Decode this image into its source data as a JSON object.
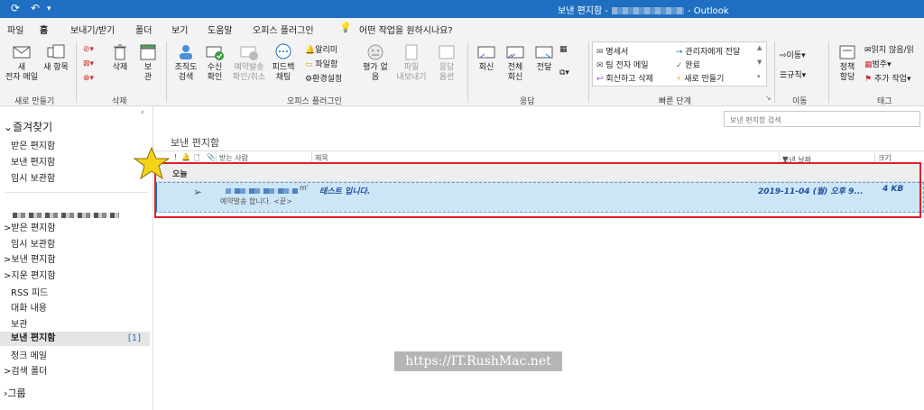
{
  "titlebar": {
    "title_prefix": "보낸 편지함 -",
    "app_name": "- Outlook"
  },
  "menu": {
    "tabs": [
      "파일",
      "홈",
      "보내기/받기",
      "폴더",
      "보기",
      "도움말",
      "오피스 플러그인"
    ],
    "tell_me": "어떤 작업을 원하시나요?"
  },
  "ribbon": {
    "new_group": {
      "new_email": "새\n전자 메일",
      "new_items": "새 항목",
      "label": "새로 만들기"
    },
    "delete_group": {
      "delete": "삭제",
      "archive": "보\n관",
      "label": "삭제"
    },
    "plugin_group": {
      "org_search": "조직도\n검색",
      "read_receipt": "수신\n확인",
      "schedule_send": "예약발송\n확인/취소",
      "feedback": "피드백\n채팅",
      "alarm": "알리미",
      "file_box": "파일함",
      "settings": "환경설정",
      "rating": "평가 없\n음",
      "file_export": "파일\n내보내기",
      "reply_options": "응답\n옵션",
      "label": "오피스 플러그인"
    },
    "respond_group": {
      "reply": "회신",
      "reply_all": "전체\n회신",
      "forward": "전달",
      "label": "응답"
    },
    "quick_steps": {
      "items": [
        "명세서",
        "팀 전자 메일",
        "회신하고 삭제",
        "관리자에게 전달",
        "완료",
        "새로 만들기"
      ],
      "label": "빠른 단계"
    },
    "move_group": {
      "move": "이동",
      "rules": "규칙",
      "label": "이동"
    },
    "tags_group": {
      "policy": "정책\n할당",
      "unread": "읽지 않음/읽",
      "categorize": "범주",
      "followup": "추가 작업",
      "label": "태그"
    }
  },
  "folders": {
    "favorites_header": "즐겨찾기",
    "favorites": [
      "받은 편지함",
      "보낸 편지함",
      "임시 보관함"
    ],
    "account": [
      {
        "label": "받은 편지함",
        "expand": ">"
      },
      {
        "label": "임시 보관함",
        "expand": ""
      },
      {
        "label": "보낸 편지함",
        "expand": ">"
      },
      {
        "label": "지운 편지함",
        "expand": ">"
      },
      {
        "label": "RSS 피드",
        "expand": ""
      },
      {
        "label": "대화 내용",
        "expand": ""
      },
      {
        "label": "보관",
        "expand": ""
      }
    ],
    "selected": {
      "label": "보낸 편지함",
      "count": "[1]"
    },
    "account_tail": [
      {
        "label": "정크 메일",
        "expand": ""
      },
      {
        "label": "검색 폴더",
        "expand": ">"
      }
    ],
    "groups": "그룹"
  },
  "list": {
    "search_placeholder": "보낸 편지함 검색",
    "folder_title": "보낸 편지함",
    "columns": {
      "to": "받는 사람",
      "subject": "제목",
      "sent_date": "보낸 날짜",
      "size": "크기"
    },
    "group_today": "오늘",
    "message": {
      "to_tail": "m'",
      "subject": "테스트 입니다.",
      "preview": "예약발송 합니다. <끝>",
      "date": "2019-11-04 (월) 오후 9...",
      "size": "4 KB"
    }
  },
  "watermark": "https://IT.RushMac.net",
  "colors": {
    "accent": "#1e6fc2",
    "selection": "#cde6f7",
    "highlight_box": "#e0202a",
    "star": "#f5d21a"
  }
}
